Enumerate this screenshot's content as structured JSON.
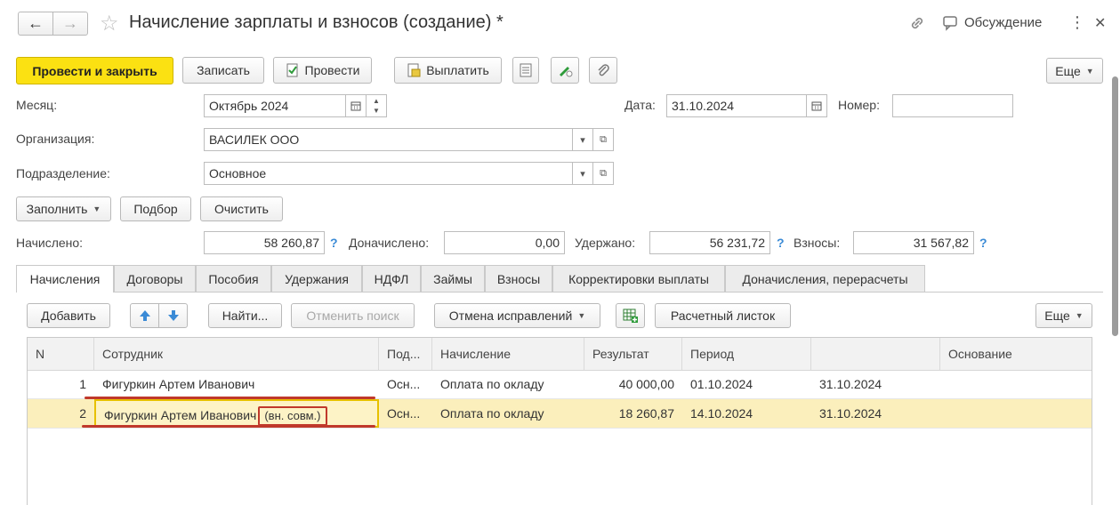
{
  "nav": {
    "back": "←",
    "forward": "→",
    "star": "☆"
  },
  "window": {
    "title": "Начисление зарплаты и взносов (создание) *",
    "discussion_label": "Обсуждение",
    "more_icon": "⋮",
    "close_icon": "✕"
  },
  "toolbar": {
    "post_close": "Провести и закрыть",
    "save": "Записать",
    "post": "Провести",
    "pay": "Выплатить",
    "more": "Еще"
  },
  "form": {
    "month_label": "Месяц:",
    "month_value": "Октябрь 2024",
    "date_label": "Дата:",
    "date_value": "31.10.2024",
    "number_label": "Номер:",
    "number_value": "",
    "org_label": "Организация:",
    "org_value": "ВАСИЛЕК ООО",
    "dept_label": "Подразделение:",
    "dept_value": "Основное"
  },
  "actions": {
    "fill": "Заполнить",
    "select": "Подбор",
    "clear": "Очистить"
  },
  "totals": {
    "accrued_label": "Начислено:",
    "accrued_value": "58 260,87",
    "extra_label": "Доначислено:",
    "extra_value": "0,00",
    "withheld_label": "Удержано:",
    "withheld_value": "56 231,72",
    "contrib_label": "Взносы:",
    "contrib_value": "31 567,82",
    "help": "?"
  },
  "tabs": [
    "Начисления",
    "Договоры",
    "Пособия",
    "Удержания",
    "НДФЛ",
    "Займы",
    "Взносы",
    "Корректировки выплаты",
    "Доначисления, перерасчеты"
  ],
  "grid_toolbar": {
    "add": "Добавить",
    "find": "Найти...",
    "cancel_search": "Отменить поиск",
    "cancel_fix": "Отмена исправлений",
    "payslip": "Расчетный листок",
    "more": "Еще"
  },
  "table": {
    "columns": [
      "N",
      "Сотрудник",
      "Под...",
      "Начисление",
      "Результат",
      "Период",
      "",
      "Основание"
    ],
    "rows": [
      {
        "n": "1",
        "employee": "Фигуркин Артем Иванович",
        "tag": "",
        "dept": "Осн...",
        "accrual": "Оплата по окладу",
        "result": "40 000,00",
        "from": "01.10.2024",
        "to": "31.10.2024",
        "basis": ""
      },
      {
        "n": "2",
        "employee": "Фигуркин Артем Иванович",
        "tag": "(вн. совм.)",
        "dept": "Осн...",
        "accrual": "Оплата по окладу",
        "result": "18 260,87",
        "from": "14.10.2024",
        "to": "31.10.2024",
        "basis": ""
      }
    ]
  },
  "colors": {
    "accent": "#fbe112",
    "selection": "#fbefbc",
    "highlight": "#c0392b",
    "link": "#3b8bd6"
  }
}
